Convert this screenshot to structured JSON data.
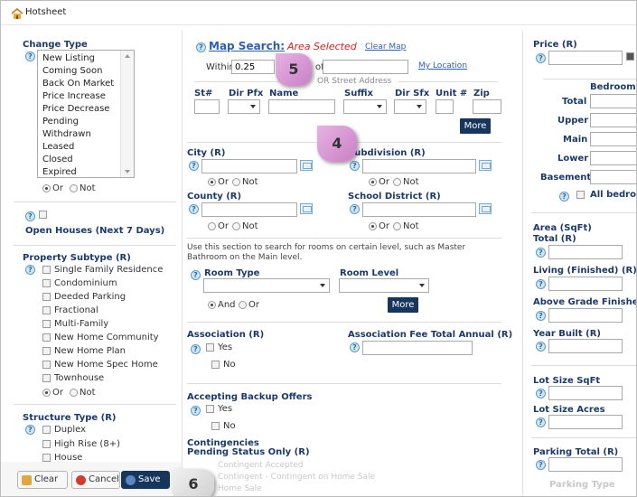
{
  "window": {
    "title": "Hotsheet"
  },
  "change_type": {
    "label": "Change Type",
    "options": [
      "New Listing",
      "Coming Soon",
      "Back On Market",
      "Price Increase",
      "Price Decrease",
      "Pending",
      "Withdrawn",
      "Leased",
      "Closed",
      "Expired"
    ],
    "or_label": "Or",
    "not_label": "Not"
  },
  "open_houses": {
    "label": "Open Houses (Next 7 Days)"
  },
  "property_subtype": {
    "label": "Property Subtype (R)",
    "options": [
      "Single Family Residence",
      "Condominium",
      "Deeded Parking",
      "Fractional",
      "Multi-Family",
      "New Home Community",
      "New Home Plan",
      "New Home Spec Home",
      "Townhouse"
    ],
    "or_label": "Or",
    "not_label": "Not"
  },
  "structure_type": {
    "label": "Structure Type (R)",
    "options": [
      "Duplex",
      "High Rise (8+)",
      "House"
    ]
  },
  "map_search": {
    "label": "Map Search:",
    "status": "Area Selected",
    "clear": "Clear Map",
    "within_label": "Within",
    "within_value": "0.25",
    "of_label": "of",
    "my_location": "My Location",
    "or_street": "OR Street Address"
  },
  "street": {
    "headers": [
      "St#",
      "Dir Pfx",
      "Name",
      "Suffix",
      "Dir Sfx",
      "Unit #",
      "Zip"
    ],
    "more": "More"
  },
  "city": {
    "label": "City (R)",
    "or_label": "Or",
    "not_label": "Not"
  },
  "subdivision": {
    "label": "Subdivision (R)",
    "or_label": "Or",
    "not_label": "Not"
  },
  "county": {
    "label": "County (R)",
    "or_label": "Or",
    "not_label": "Not"
  },
  "school_district": {
    "label": "School District (R)",
    "or_label": "Or",
    "not_label": "Not"
  },
  "rooms": {
    "note": "Use this section to search for rooms on certain level, such as Master Bathroom on the Main level.",
    "room_type": "Room Type",
    "room_level": "Room Level",
    "and_label": "And",
    "or_label": "Or",
    "more": "More"
  },
  "association": {
    "label": "Association (R)",
    "yes": "Yes",
    "no": "No"
  },
  "association_fee": {
    "label": "Association Fee Total Annual (R)"
  },
  "backup_offers": {
    "label": "Accepting Backup Offers",
    "yes": "Yes",
    "no": "No"
  },
  "contingencies": {
    "label": "Contingencies",
    "pending_label": "Pending Status Only (R)",
    "faded_1": "Contingent Accepted",
    "faded_2": "Contingent - Contingent on Home Sale",
    "faded_3": "Home Sale"
  },
  "price": {
    "label": "Price (R)"
  },
  "bedrooms": {
    "label": "Bedrooms",
    "rows": [
      "Total",
      "Upper",
      "Main",
      "Lower",
      "Basement"
    ],
    "all": "All bedro"
  },
  "area": {
    "label": "Area (SqFt)",
    "total": "Total (R)",
    "living": "Living (Finished) (R)",
    "above": "Above Grade Finished"
  },
  "year_built": {
    "label": "Year Built (R)"
  },
  "lot_size_sqft": {
    "label": "Lot Size SqFt"
  },
  "lot_size_acres": {
    "label": "Lot Size Acres"
  },
  "parking_total": {
    "label": "Parking Total (R)"
  },
  "parking_type": {
    "label": "Parking Type"
  },
  "footer": {
    "clear": "Clear",
    "cancel": "Cancel",
    "save": "Save"
  },
  "callouts": {
    "b4": "4",
    "b5": "5",
    "b6": "6"
  },
  "colors": {
    "badge": "#c97fc6",
    "navy": "#17365d",
    "red_status": "#d22222",
    "link": "#2d5fb3"
  }
}
